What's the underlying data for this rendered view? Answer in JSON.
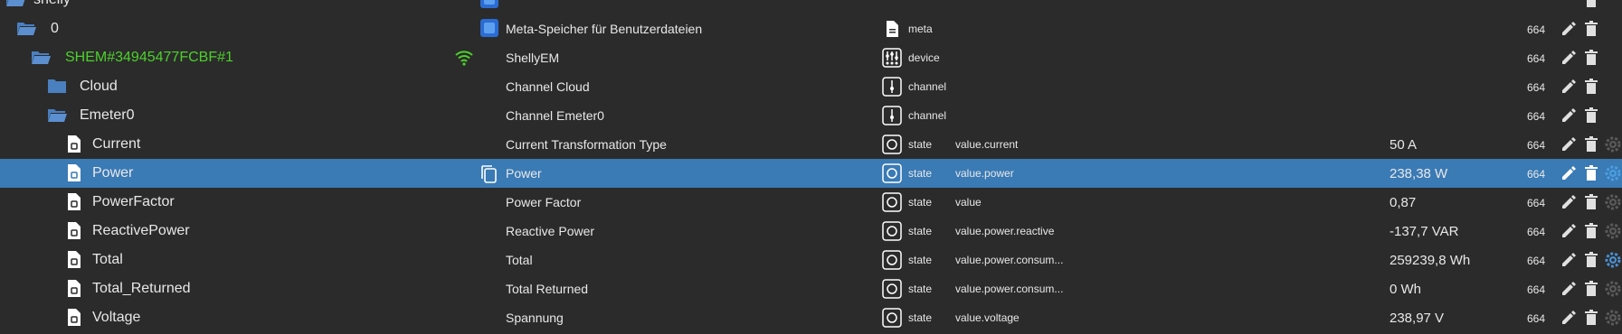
{
  "colors": {
    "background": "#2b2b2b",
    "selected": "#3a7ab5",
    "folder": "#4a7fc0",
    "online": "#4cd12b",
    "text": "#e8e8e8"
  },
  "rows": [
    {
      "name": "shelly",
      "desc": "",
      "type": "",
      "role": "",
      "value": "",
      "acl": "",
      "icon": "folder-open-icon"
    },
    {
      "name": "0",
      "desc": "Meta-Speicher für Benutzerdateien",
      "type": "meta",
      "role": "",
      "value": "",
      "acl": "664",
      "icon": "folder-open-icon"
    },
    {
      "name": "SHEM#34945477FCBF#1",
      "desc": "ShellyEM",
      "type": "device",
      "role": "",
      "value": "",
      "acl": "664",
      "icon": "folder-open-icon"
    },
    {
      "name": "Cloud",
      "desc": "Channel Cloud",
      "type": "channel",
      "role": "",
      "value": "",
      "acl": "664",
      "icon": "folder-icon"
    },
    {
      "name": "Emeter0",
      "desc": "Channel Emeter0",
      "type": "channel",
      "role": "",
      "value": "",
      "acl": "664",
      "icon": "folder-open-icon"
    },
    {
      "name": "Current",
      "desc": "Current Transformation Type",
      "type": "state",
      "role": "value.current",
      "value": "50 A",
      "acl": "664",
      "icon": "file-icon"
    },
    {
      "name": "Power",
      "desc": "Power",
      "type": "state",
      "role": "value.power",
      "value": "238,38 W",
      "acl": "664",
      "icon": "file-icon"
    },
    {
      "name": "PowerFactor",
      "desc": "Power Factor",
      "type": "state",
      "role": "value",
      "value": "0,87",
      "acl": "664",
      "icon": "file-icon"
    },
    {
      "name": "ReactivePower",
      "desc": "Reactive Power",
      "type": "state",
      "role": "value.power.reactive",
      "value": "-137,7 VAR",
      "acl": "664",
      "icon": "file-icon"
    },
    {
      "name": "Total",
      "desc": "Total",
      "type": "state",
      "role": "value.power.consum...",
      "value": "259239,8 Wh",
      "acl": "664",
      "icon": "file-icon"
    },
    {
      "name": "Total_Returned",
      "desc": "Total Returned",
      "type": "state",
      "role": "value.power.consum...",
      "value": "0 Wh",
      "acl": "664",
      "icon": "file-icon"
    },
    {
      "name": "Voltage",
      "desc": "Spannung",
      "type": "state",
      "role": "value.voltage",
      "value": "238,97 V",
      "acl": "664",
      "icon": "file-icon"
    }
  ]
}
